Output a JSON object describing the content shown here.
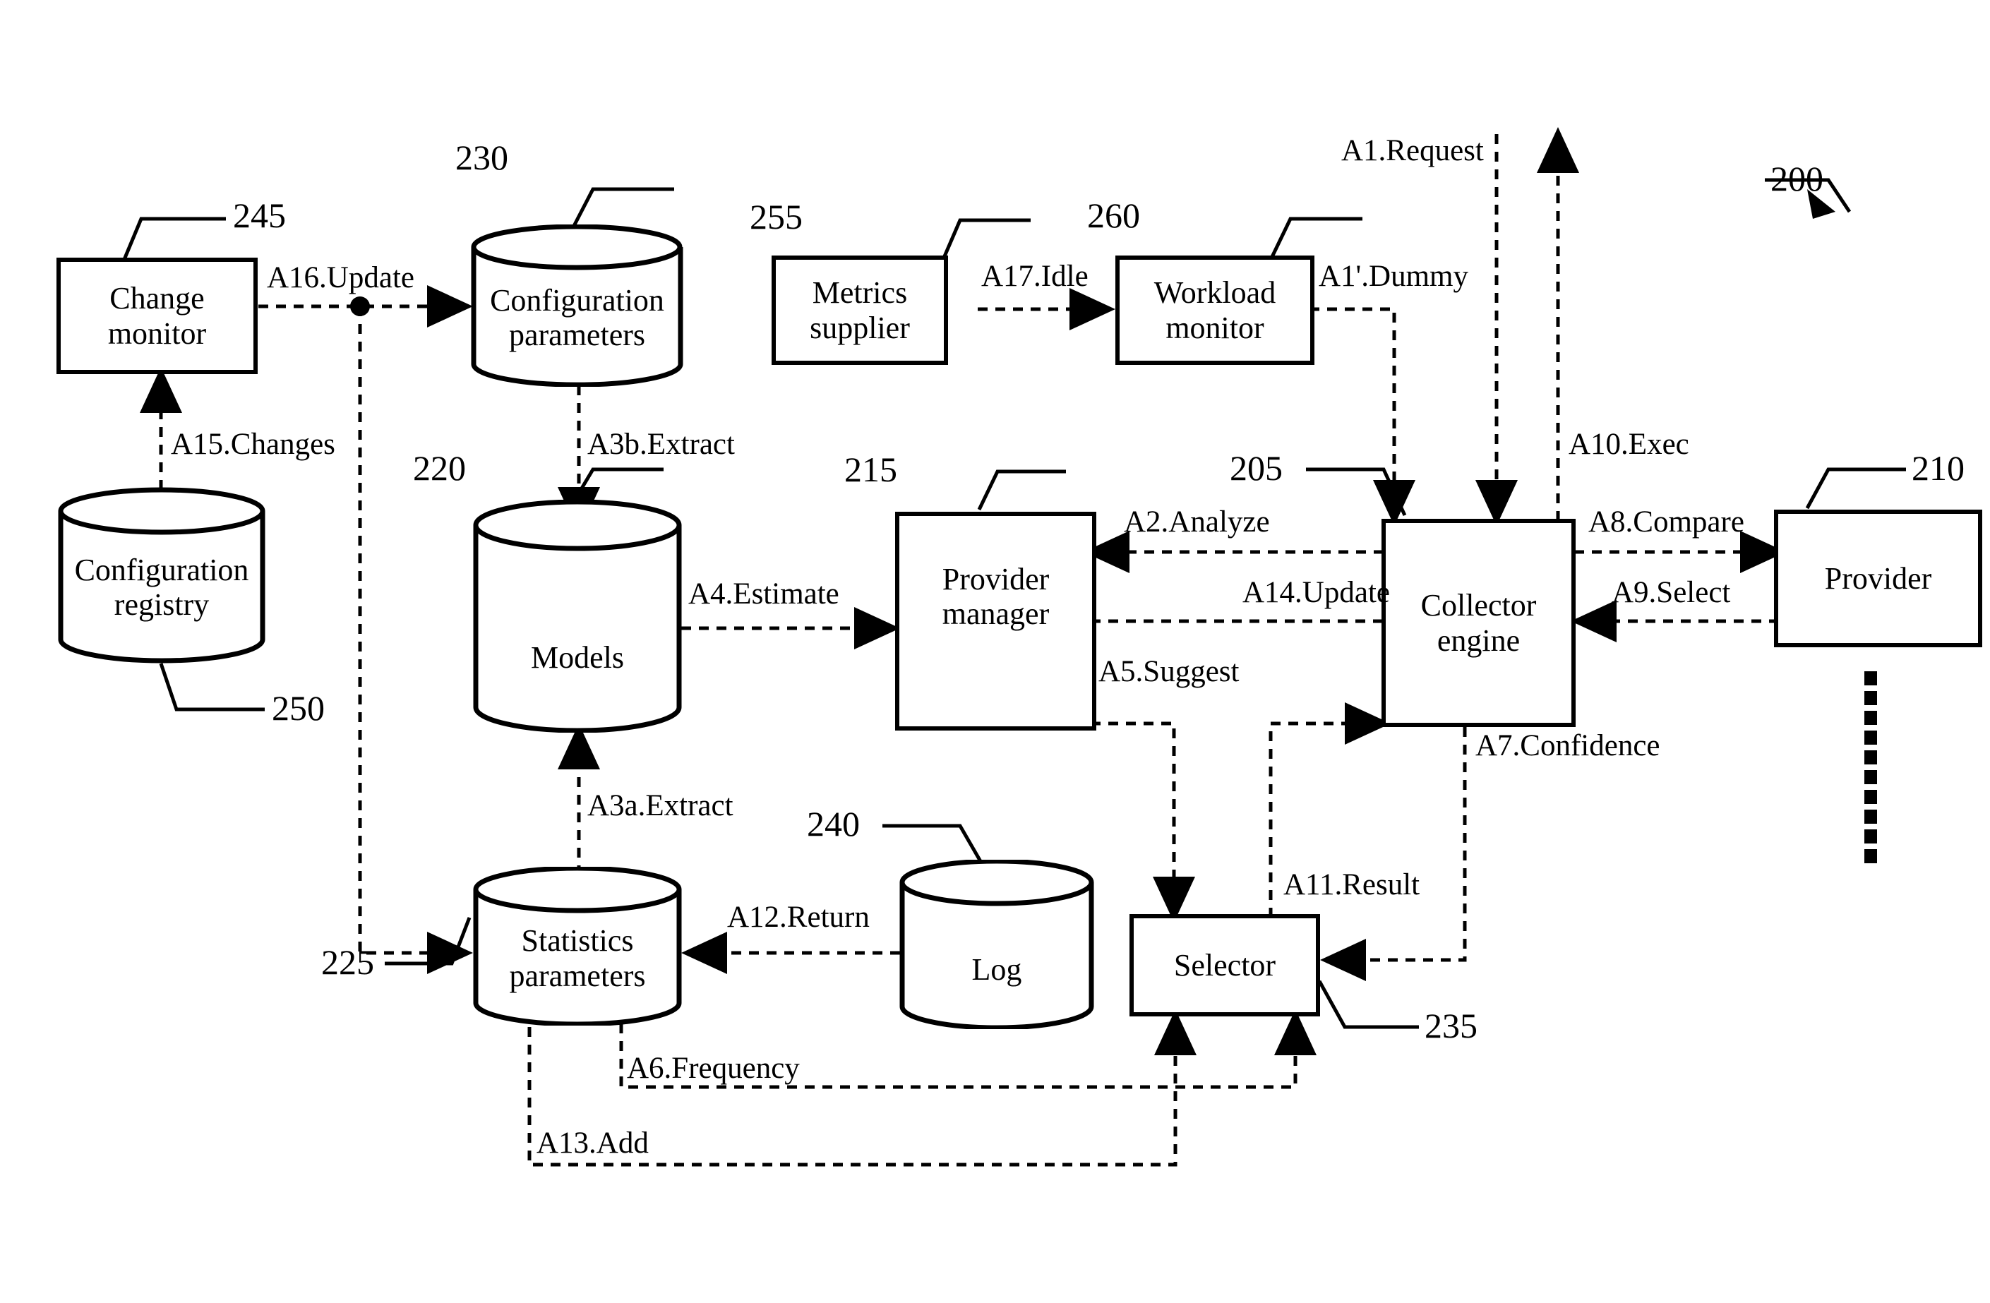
{
  "figure": {
    "reference": "200",
    "nodes": [
      {
        "id": "change-monitor",
        "label": "Change\nmonitor",
        "ref": "245",
        "shape": "box"
      },
      {
        "id": "configuration-registry",
        "label": "Configuration\nregistry",
        "ref": "250",
        "shape": "cylinder"
      },
      {
        "id": "configuration-parameters",
        "label": "Configuration\nparameters",
        "ref": "230",
        "shape": "cylinder"
      },
      {
        "id": "models",
        "label": "Models",
        "ref": "220",
        "shape": "cylinder"
      },
      {
        "id": "statistics-parameters",
        "label": "Statistics\nparameters",
        "ref": "225",
        "shape": "cylinder"
      },
      {
        "id": "log",
        "label": "Log",
        "ref": "240",
        "shape": "cylinder"
      },
      {
        "id": "metrics-supplier",
        "label": "Metrics\nsupplier",
        "ref": "255",
        "shape": "box"
      },
      {
        "id": "workload-monitor",
        "label": "Workload\nmonitor",
        "ref": "260",
        "shape": "box"
      },
      {
        "id": "provider-manager",
        "label": "Provider\nmanager",
        "ref": "215",
        "shape": "box"
      },
      {
        "id": "collector-engine",
        "label": "Collector\nengine",
        "ref": "205",
        "shape": "box"
      },
      {
        "id": "provider",
        "label": "Provider",
        "ref": "210",
        "shape": "box"
      },
      {
        "id": "selector",
        "label": "Selector",
        "ref": "235",
        "shape": "box"
      }
    ],
    "flows": [
      {
        "id": "a1-request",
        "label": "A1.Request",
        "from": "external",
        "to": "collector-engine"
      },
      {
        "id": "a1p-dummy",
        "label": "A1'.Dummy",
        "from": "workload-monitor",
        "to": "collector-engine"
      },
      {
        "id": "a2-analyze",
        "label": "A2.Analyze",
        "from": "collector-engine",
        "to": "provider-manager"
      },
      {
        "id": "a3a-extract",
        "label": "A3a.Extract",
        "from": "statistics-parameters",
        "to": "models"
      },
      {
        "id": "a3b-extract",
        "label": "A3b.Extract",
        "from": "configuration-parameters",
        "to": "models"
      },
      {
        "id": "a4-estimate",
        "label": "A4.Estimate",
        "from": "models",
        "to": "provider-manager"
      },
      {
        "id": "a5-suggest",
        "label": "A5.Suggest",
        "from": "provider-manager",
        "to": "selector"
      },
      {
        "id": "a6-frequency",
        "label": "A6.Frequency",
        "from": "statistics-parameters",
        "to": "selector"
      },
      {
        "id": "a7-confidence",
        "label": "A7.Confidence",
        "from": "statistics-parameters",
        "to": "selector"
      },
      {
        "id": "a8-compare",
        "label": "A8.Compare",
        "from": "collector-engine",
        "to": "selector"
      },
      {
        "id": "a9-select",
        "label": "A9.Select",
        "from": "selector",
        "to": "collector-engine"
      },
      {
        "id": "a10-exec",
        "label": "A10.Exec",
        "from": "collector-engine",
        "to": "provider"
      },
      {
        "id": "a11-result",
        "label": "A11.Result",
        "from": "provider",
        "to": "collector-engine"
      },
      {
        "id": "a12-return",
        "label": "A12.Return",
        "from": "collector-engine",
        "to": "external"
      },
      {
        "id": "a13-add",
        "label": "A13.Add",
        "from": "provider-manager",
        "to": "collector-engine"
      },
      {
        "id": "a14-update",
        "label": "A14.Update",
        "from": "log",
        "to": "statistics-parameters"
      },
      {
        "id": "a15-changes",
        "label": "A15.Changes",
        "from": "configuration-registry",
        "to": "change-monitor"
      },
      {
        "id": "a16-update",
        "label": "A16.Update",
        "from": "change-monitor",
        "to": "configuration-parameters"
      },
      {
        "id": "a17-idle",
        "label": "A17.Idle",
        "from": "metrics-supplier",
        "to": "workload-monitor"
      }
    ]
  }
}
